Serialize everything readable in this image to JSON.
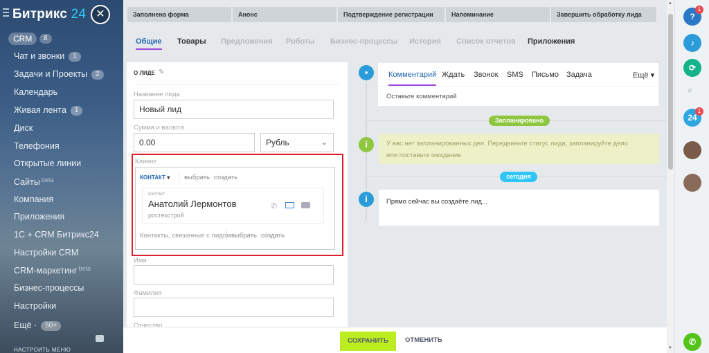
{
  "sidebar": {
    "logo_main": "Битрикс",
    "logo_num": "24",
    "crm_label": "CRM",
    "crm_count": "8",
    "items": [
      {
        "label": "Чат и звонки",
        "count": "1"
      },
      {
        "label": "Задачи и Проекты",
        "count": "2"
      },
      {
        "label": "Календарь"
      },
      {
        "label": "Живая лента",
        "count": "1"
      },
      {
        "label": "Диск"
      },
      {
        "label": "Телефония"
      },
      {
        "label": "Открытые линии"
      },
      {
        "label": "Сайты",
        "sup": "beta"
      },
      {
        "label": "Компания"
      },
      {
        "label": "Приложения"
      },
      {
        "label": "1С + CRM Битрикс24"
      },
      {
        "label": "Настройки CRM"
      },
      {
        "label": "CRM-маркетинг",
        "sup": "beta"
      },
      {
        "label": "Бизнес-процессы"
      },
      {
        "label": "Настройки"
      },
      {
        "label": "Ещё ·",
        "count": "50+"
      }
    ],
    "configure": "НАСТРОИТЬ МЕНЮ"
  },
  "stages": [
    "Заполнена форма",
    "Анонс",
    "Подтверждение регистрации",
    "Напоминание",
    "Завершить обработку лида"
  ],
  "tabs": [
    "Общие",
    "Товары",
    "Предложения",
    "Роботы",
    "Бизнес-процессы",
    "История",
    "Список отчетов",
    "Приложения"
  ],
  "form": {
    "section_title": "О ЛИДЕ",
    "lead_name_label": "Название лида",
    "lead_name_value": "Новый лид",
    "amount_label": "Сумма и валюта",
    "amount_value": "0.00",
    "currency_value": "Рубль",
    "client_label": "Клиент",
    "contact_tab": "КОНТАКТ",
    "choose": "выбрать",
    "create": "создать",
    "contact_type": "контакт",
    "contact_name": "Анатолий Лермонтов",
    "contact_company": "ростехстрой",
    "related_contacts": "Контакты, связанные с лидом",
    "name_label": "Имя",
    "surname_label": "Фамилия",
    "middle_label": "Отчество"
  },
  "timeline": {
    "tabs": [
      "Комментарий",
      "Ждать",
      "Звонок",
      "SMS",
      "Письмо",
      "Задача"
    ],
    "more": "Ещё",
    "comment_placeholder": "Оставьте комментарий",
    "planned": "Запланировано",
    "planned_text_1": "У вас нет запланированных дел. Передвиньте статус лида, запланируйте дело",
    "planned_text_2": "или поставьте ожидание.",
    "today": "сегодня",
    "creating_text": "Прямо сейчас вы создаёте лид..."
  },
  "footer": {
    "save": "СОХРАНИТЬ",
    "cancel": "ОТМЕНИТЬ"
  },
  "right": {
    "help_badge": "1",
    "b24": "24",
    "b24_badge": "1"
  },
  "colors": {
    "accent": "#2067b0",
    "save": "#bbed21",
    "planned": "#8ec63f",
    "today": "#2fc6f6",
    "highlight": "#e01e2a"
  }
}
